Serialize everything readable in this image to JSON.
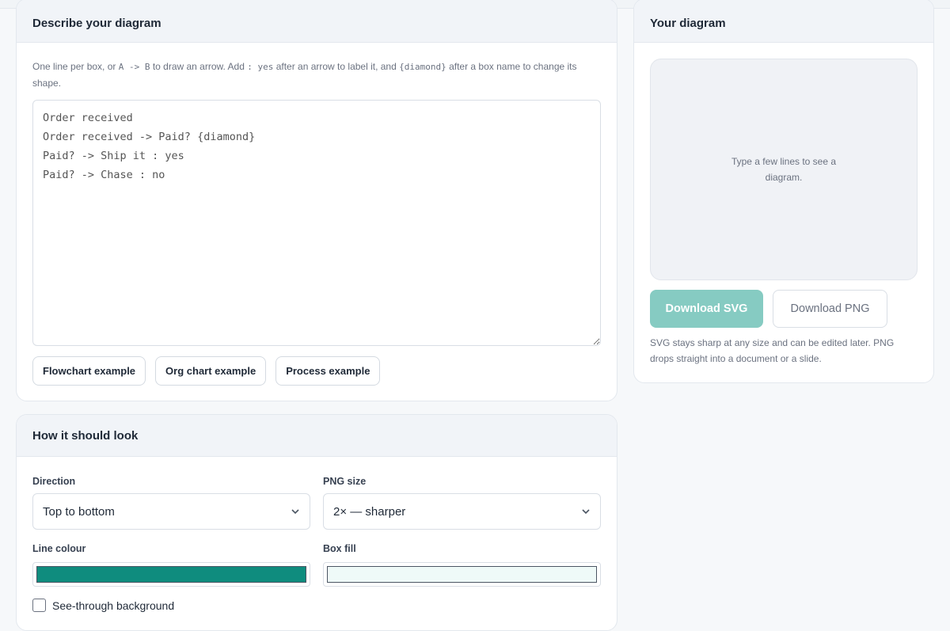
{
  "describe": {
    "title": "Describe your diagram",
    "help_parts": {
      "a": "One line per box, or ",
      "code1": "A -> B",
      "b": " to draw an arrow. Add ",
      "code2": ": yes",
      "c": " after an arrow to label it, and ",
      "code3": "{diamond}",
      "d": " after a box name to change its shape."
    },
    "editor_value": "Order received\nOrder received -> Paid? {diamond}\nPaid? -> Ship it : yes\nPaid? -> Chase : no",
    "examples": [
      "Flowchart example",
      "Org chart example",
      "Process example"
    ]
  },
  "look": {
    "title": "How it should look",
    "direction_label": "Direction",
    "direction_value": "Top to bottom",
    "png_size_label": "PNG size",
    "png_size_value": "2× — sharper",
    "line_colour_label": "Line colour",
    "line_colour": "#0f8c7e",
    "box_fill_label": "Box fill",
    "box_fill": "#effaf8",
    "transparent_label": "See-through background"
  },
  "diagram": {
    "title": "Your diagram",
    "placeholder": "Type a few lines to see a diagram.",
    "download_svg": "Download SVG",
    "download_png": "Download PNG",
    "note": "SVG stays sharp at any size and can be edited later. PNG drops straight into a document or a slide."
  }
}
